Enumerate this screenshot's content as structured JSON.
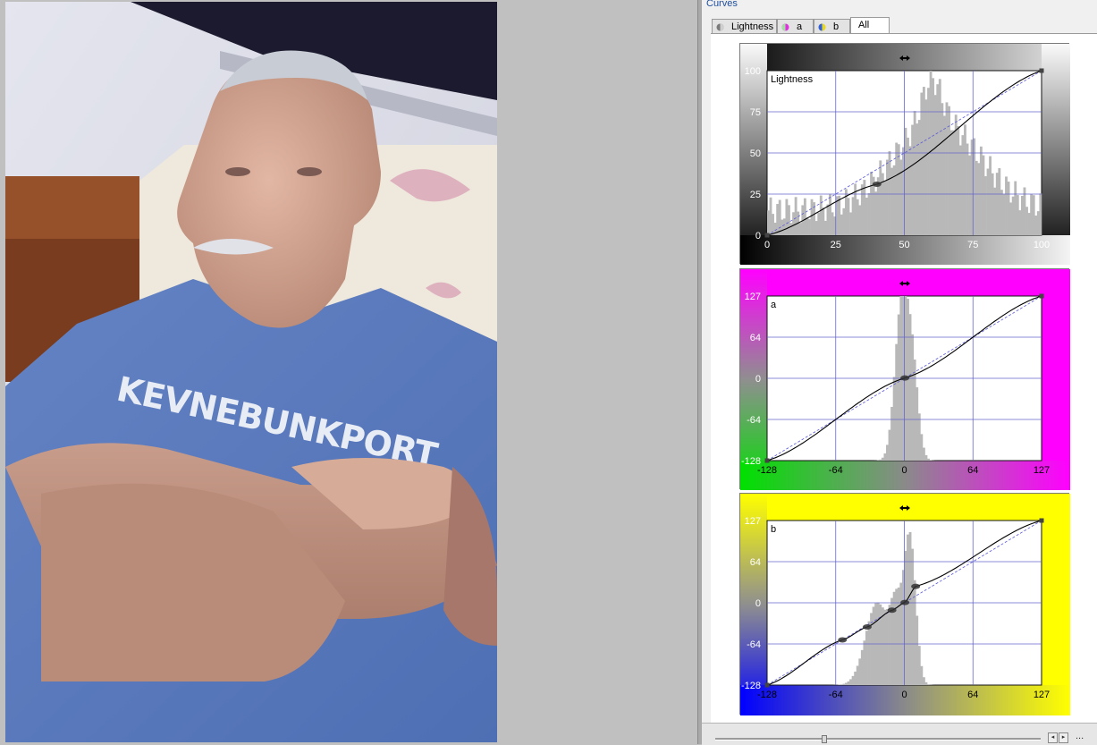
{
  "panel": {
    "title": "Curves"
  },
  "tabs": [
    {
      "label": "Lightness",
      "icon": "lightness-icon",
      "active": false
    },
    {
      "label": "a",
      "icon": "a-channel-icon",
      "active": false
    },
    {
      "label": "b",
      "icon": "b-channel-icon",
      "active": false
    },
    {
      "label": "All",
      "icon": "",
      "active": true
    }
  ],
  "photo": {
    "shirt_text": "KEVNEBUNKPORT",
    "colors": {
      "shirt": "#5d7fc0",
      "skin": "#c49884",
      "wall": "#dfe0ea",
      "hair": "#c8ccd4"
    }
  },
  "curves": [
    {
      "name": "Lightness",
      "label": "Lightness",
      "x_ticks": [
        "0",
        "25",
        "50",
        "75",
        "100"
      ],
      "y_ticks": [
        "100",
        "75",
        "50",
        "25",
        "0"
      ],
      "range": [
        0,
        100
      ],
      "control_points": [
        [
          0,
          0
        ],
        [
          40,
          31
        ],
        [
          100,
          100
        ]
      ],
      "colors": {
        "left": "#000000",
        "right": "#f2f2f2",
        "top": "#7a7a7a",
        "bottom": "#000000"
      }
    },
    {
      "name": "a",
      "label": "a",
      "x_ticks": [
        "-128",
        "-64",
        "0",
        "64",
        "127"
      ],
      "y_ticks": [
        "127",
        "64",
        "0",
        "-64",
        "-128"
      ],
      "range": [
        -128,
        127
      ],
      "control_points": [
        [
          -128,
          -128
        ],
        [
          0,
          0
        ],
        [
          127,
          127
        ]
      ],
      "colors": {
        "left": "#00e000",
        "right": "#ff00ff"
      }
    },
    {
      "name": "b",
      "label": "b",
      "x_ticks": [
        "-128",
        "-64",
        "0",
        "64",
        "127"
      ],
      "y_ticks": [
        "127",
        "64",
        "0",
        "-64",
        "-128"
      ],
      "range": [
        -128,
        127
      ],
      "control_points": [
        [
          -128,
          -128
        ],
        [
          -58,
          -58
        ],
        [
          -35,
          -38
        ],
        [
          -12,
          -12
        ],
        [
          0,
          0
        ],
        [
          10,
          25
        ],
        [
          127,
          127
        ]
      ],
      "colors": {
        "left": "#0000ff",
        "right": "#ffff00"
      }
    }
  ],
  "zoom": {
    "value": 0.33
  },
  "more_button": "..."
}
